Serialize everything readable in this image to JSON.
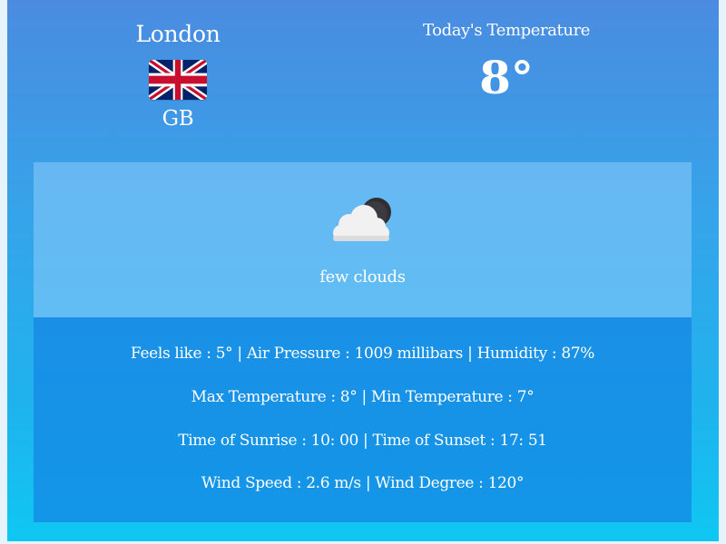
{
  "location": {
    "city": "London",
    "country": "GB",
    "flag_icon": "uk-flag-icon"
  },
  "temperature": {
    "label": "Today's Temperature",
    "value": "8°"
  },
  "condition": {
    "icon": "few-clouds-night-icon",
    "description": "few clouds"
  },
  "details": {
    "line1": {
      "feels_like": "Feels like : 5°",
      "air_pressure": "Air Pressure : 1009 millibars",
      "humidity": "Humidity : 87%"
    },
    "line2": {
      "max_temp": "Max Temperature : 8°",
      "min_temp": "Min Temperature : 7°"
    },
    "line3": {
      "sunrise": "Time of Sunrise : 10: 00",
      "sunset": "Time of Sunset : 17: 51"
    },
    "line4": {
      "wind_speed": "Wind Speed : 2.6 m/s",
      "wind_degree": "Wind Degree : 120°"
    },
    "separator": " | "
  },
  "colors": {
    "gradient_top": "#4a8be0",
    "gradient_bottom": "#0fc7f2",
    "condition_panel": "#82c8f8",
    "details_panel": "#1487e4",
    "text": "#ffffff"
  }
}
